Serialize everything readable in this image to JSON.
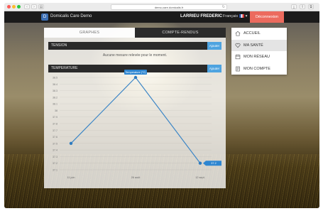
{
  "browser": {
    "url": "demo-care.domicalis.fr",
    "buttons": {
      "back": "‹",
      "forward": "›",
      "sidebar": "▤",
      "reload": "↻",
      "share": "⇪",
      "tabs": "⧉",
      "download": "⤓"
    }
  },
  "header": {
    "logo_glyph": "D",
    "app_title": "Domicalis Care Demo",
    "user_name": "LARRIEU FREDERIC",
    "language": "Français",
    "language_caret": "▾",
    "logout_label": "Déconnexion"
  },
  "tabs": [
    {
      "label": "GRAPHES",
      "active": true
    },
    {
      "label": "COMPTE-RENDUS",
      "active": false
    }
  ],
  "sections": {
    "tension": {
      "title": "TENSION",
      "button": "Ajouter",
      "empty_message": "Aucune mesure relevée pour le moment."
    },
    "temperature": {
      "title": "TEMPERATURE",
      "button": "Ajouter"
    }
  },
  "chart_data": {
    "type": "line",
    "title": "",
    "xlabel": "",
    "ylabel": "",
    "categories": [
      "11 juin",
      "26 août",
      "12 sept."
    ],
    "series": [
      {
        "name": "Temperature (°C)",
        "values": [
          37.5,
          38.5,
          37.2
        ]
      }
    ],
    "y_ticks": [
      "38.5",
      "38.4",
      "38.3",
      "38.2",
      "38.1",
      "38",
      "37.9",
      "37.8",
      "37.7",
      "37.6",
      "37.5",
      "37.4",
      "37.3",
      "37.2",
      "37.1"
    ],
    "ylim": [
      37.1,
      38.5
    ],
    "last_value_label": "37.2",
    "legend": "Temperature (°C)",
    "grid": true,
    "colors": {
      "line": "#3d86c6",
      "point": "#2e7bbf",
      "label_bg": "#2e86d1"
    }
  },
  "menu": {
    "items": [
      {
        "label": "ACCUEIL",
        "icon": "home-icon",
        "active": false
      },
      {
        "label": "MA SANTÉ",
        "icon": "heart-icon",
        "active": true
      },
      {
        "label": "MON RÉSEAU",
        "icon": "network-icon",
        "active": false
      },
      {
        "label": "MON COMPTE",
        "icon": "account-icon",
        "active": false
      }
    ]
  },
  "colors": {
    "header": "#1b1b1b",
    "logout": "#ec6b5e",
    "accent": "#4ea3e0"
  }
}
